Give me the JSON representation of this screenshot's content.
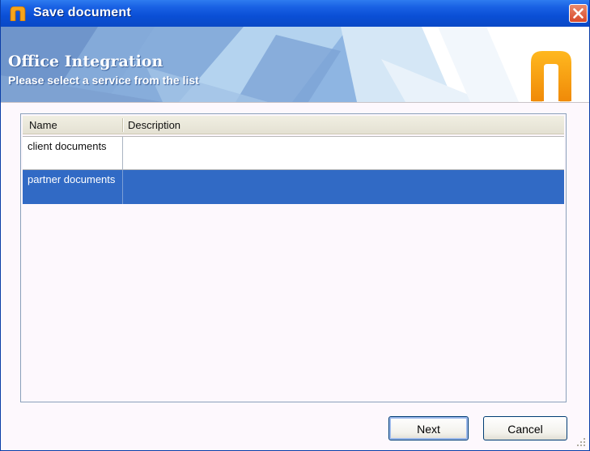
{
  "window": {
    "title": "Save document"
  },
  "banner": {
    "title": "Office Integration",
    "subtitle": "Please select a service from the list"
  },
  "list": {
    "columns": [
      "Name",
      "Description"
    ],
    "rows": [
      {
        "name": "client documents",
        "description": "",
        "selected": false
      },
      {
        "name": "partner documents",
        "description": "",
        "selected": true
      }
    ]
  },
  "buttons": {
    "next": "Next",
    "cancel": "Cancel"
  },
  "colors": {
    "titlebar": "#0a4fd6",
    "selection": "#316ac5",
    "logo": "#f79a10",
    "close": "#d8492a"
  },
  "icons": {
    "app": "brand-logo-icon",
    "close": "close-icon"
  }
}
